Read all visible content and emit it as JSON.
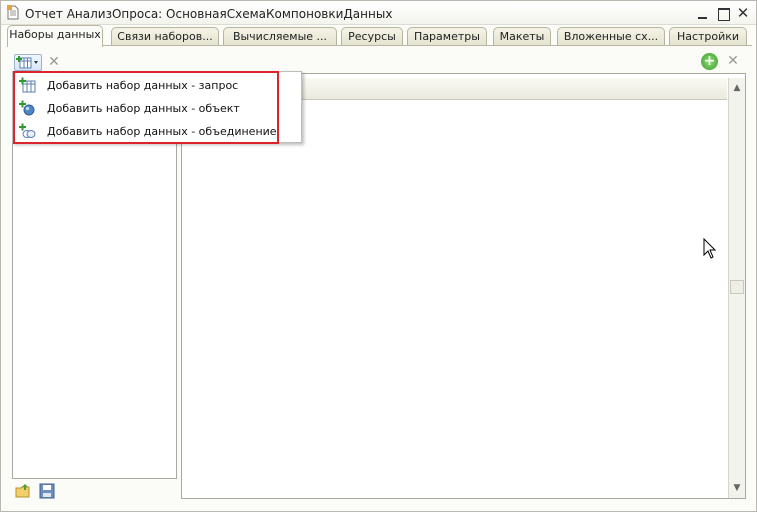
{
  "window": {
    "title": "Отчет АнализОпроса: ОсновнаяСхемаКомпоновкиДанных"
  },
  "tabs": [
    {
      "label": "Наборы данных",
      "active": true
    },
    {
      "label": "Связи наборов..."
    },
    {
      "label": "Вычисляемые ..."
    },
    {
      "label": "Ресурсы"
    },
    {
      "label": "Параметры"
    },
    {
      "label": "Макеты"
    },
    {
      "label": "Вложенные сх..."
    },
    {
      "label": "Настройки"
    }
  ],
  "add_menu": {
    "items": [
      {
        "label": "Добавить набор данных - запрос",
        "icon": "query-dataset-icon"
      },
      {
        "label": "Добавить набор данных - объект",
        "icon": "object-dataset-icon"
      },
      {
        "label": "Добавить набор данных - объединение",
        "icon": "union-dataset-icon"
      }
    ],
    "highlight_color": "#d9252b"
  },
  "colors": {
    "window_bg": "#fbfbf7",
    "tab_bg": "#e4e2cf",
    "add_green": "#3d9c2c"
  }
}
